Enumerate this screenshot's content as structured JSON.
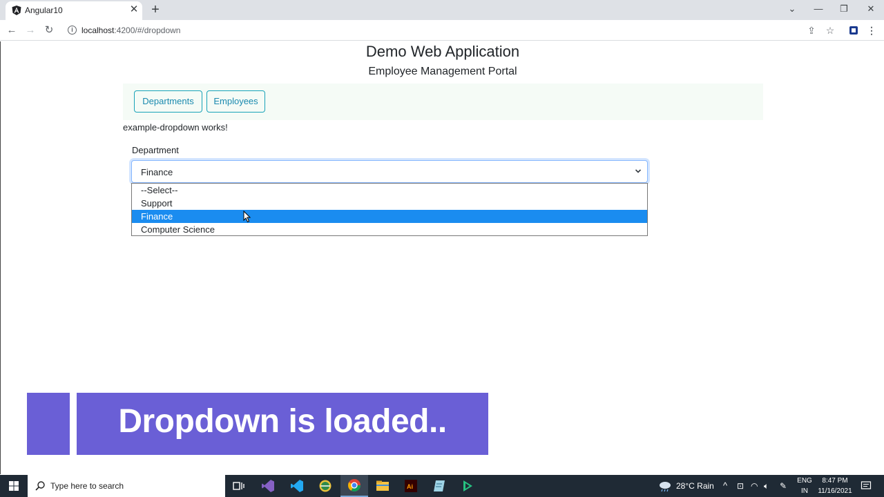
{
  "browser": {
    "tab_title": "Angular10",
    "tab_close": "✕",
    "new_tab": "+",
    "url_host": "localhost",
    "url_path": ":4200/#/dropdown"
  },
  "page": {
    "title": "Demo Web Application",
    "subtitle": "Employee Management Portal",
    "nav_buttons": [
      "Departments",
      "Employees"
    ],
    "component_text": "example-dropdown works!",
    "department_label": "Department",
    "select_value": "Finance",
    "options": [
      "--Select--",
      "Support",
      "Finance",
      "Computer Science"
    ],
    "highlighted_option": "Finance"
  },
  "banner": {
    "text": "Dropdown is loaded.."
  },
  "taskbar": {
    "search_placeholder": "Type here to search",
    "weather": "28°C  Rain",
    "language_top": "ENG",
    "language_bottom": "IN",
    "time": "8:47 PM",
    "date": "11/16/2021"
  },
  "colors": {
    "accent": "#17a2b8",
    "highlight": "#1a8cf0",
    "banner": "#6a5fd6"
  }
}
